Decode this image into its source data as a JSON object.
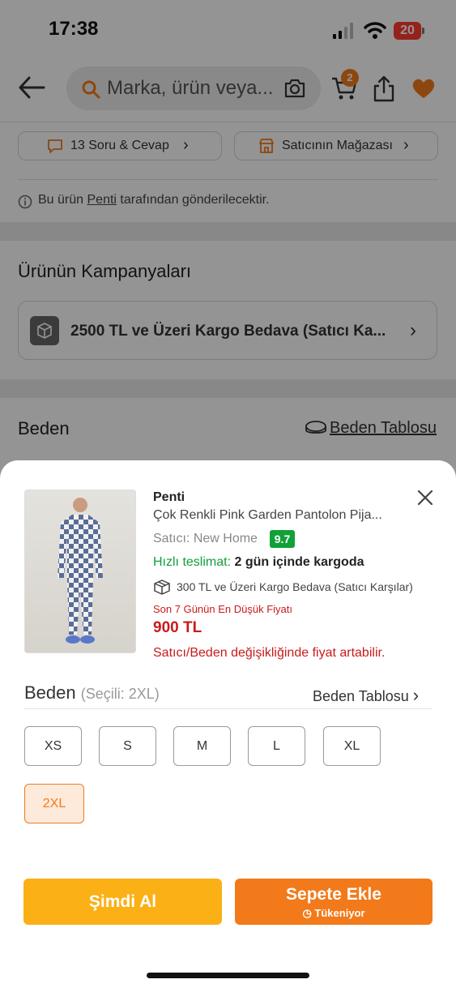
{
  "status_bar": {
    "time": "17:38",
    "battery": "20"
  },
  "header": {
    "search_placeholder": "Marka, ürün veya...",
    "cart_count": "2"
  },
  "chips": {
    "qa_label": "13 Soru & Cevap",
    "store_label": "Satıcının Mağazası"
  },
  "info": {
    "prefix": "Bu ürün",
    "seller_link": "Penti",
    "suffix": "tarafından gönderilecektir."
  },
  "campaigns": {
    "title": "Ürünün Kampanyaları",
    "item": "2500 TL ve Üzeri Kargo Bedava (Satıcı Ka..."
  },
  "size_section_bg": {
    "title": "Beden",
    "table_link": "Beden Tablosu"
  },
  "sheet": {
    "brand": "Penti",
    "product_name": "Çok Renkli Pink Garden Pantolon Pija...",
    "seller_label": "Satıcı:",
    "seller_name": "New Home",
    "seller_score": "9.7",
    "fast_label": "Hızlı teslimat:",
    "fast_value": "2 gün içinde kargoda",
    "shipping_note": "300 TL ve Üzeri Kargo Bedava (Satıcı Karşılar)",
    "lowest_label": "Son 7 Günün En Düşük Fiyatı",
    "price": "900 TL",
    "warning": "Satıcı/Beden değişikliğinde fiyat artabilir.",
    "size_title": "Beden",
    "size_selected": "(Seçili: 2XL)",
    "size_table": "Beden Tablosu",
    "sizes": [
      "XS",
      "S",
      "M",
      "L",
      "XL",
      "2XL"
    ],
    "selected_size": "2XL",
    "buy_now": "Şimdi Al",
    "add_to_cart": "Sepete Ekle",
    "stock_status": "Tükeniyor"
  },
  "colors": {
    "accent": "#f27a1a",
    "buy_now": "#fbb015",
    "price_red": "#c81b1b",
    "score_green": "#10a138"
  }
}
